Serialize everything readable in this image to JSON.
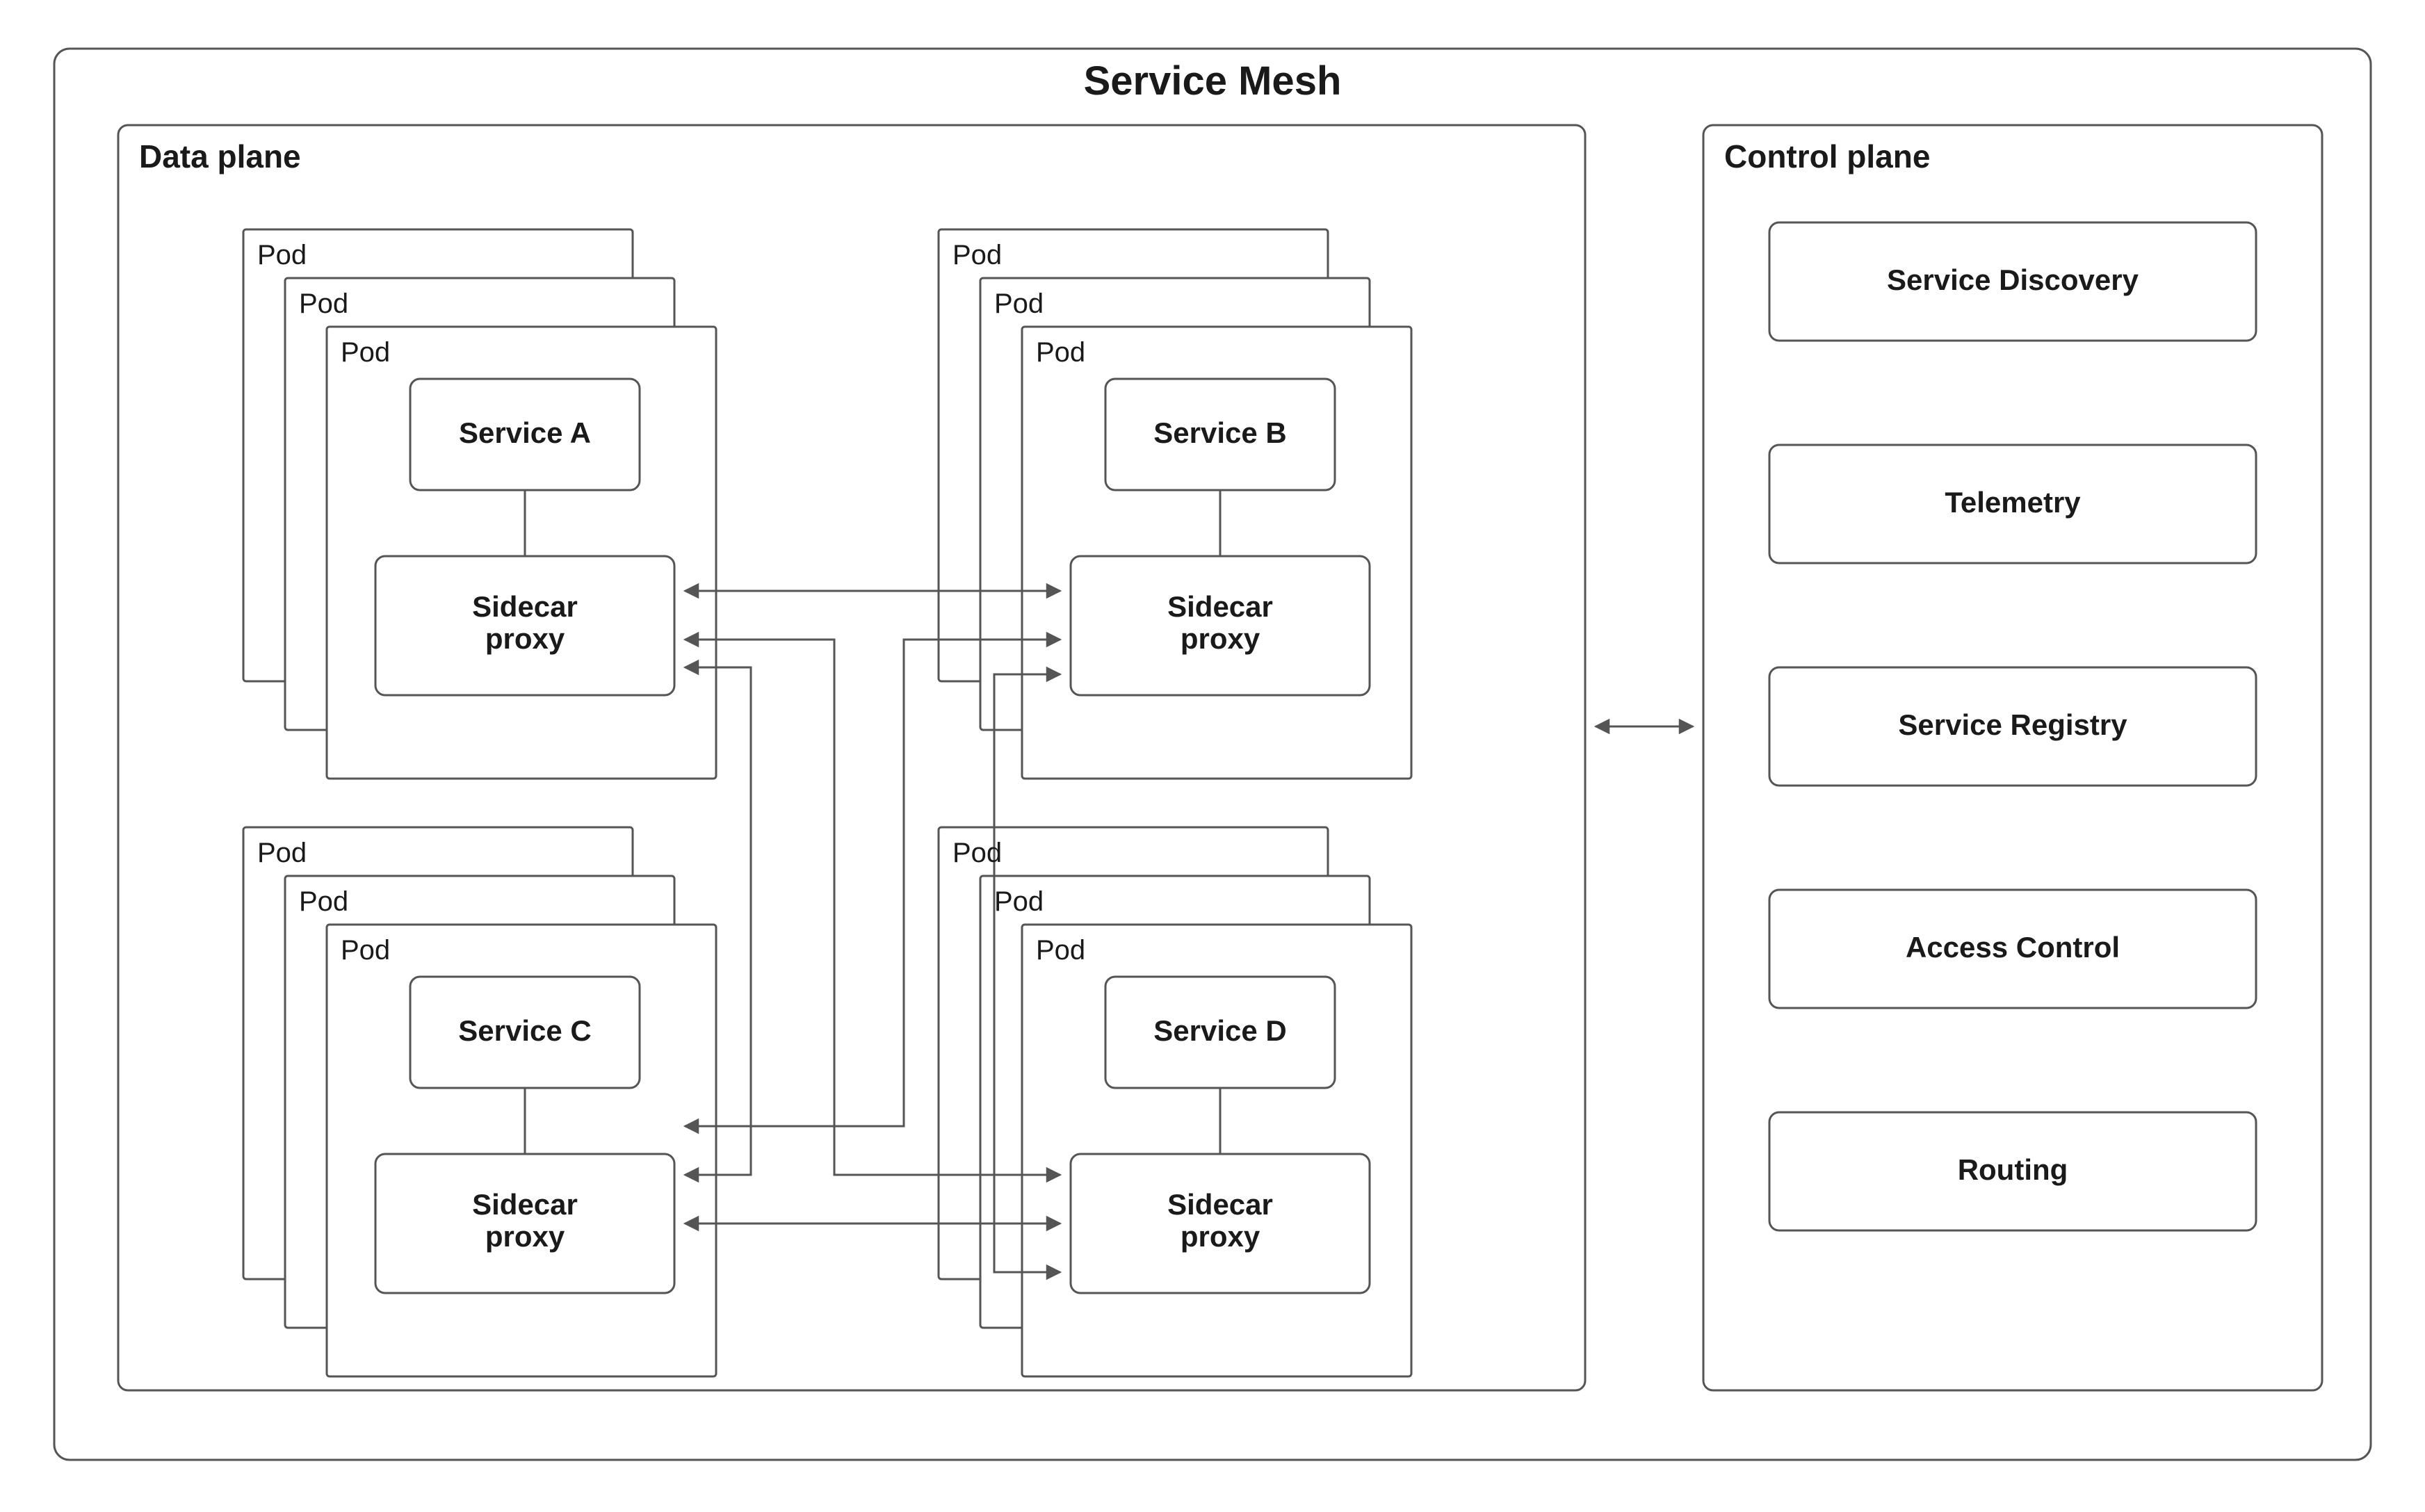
{
  "title": "Service Mesh",
  "data_plane": {
    "label": "Data plane",
    "pods": [
      {
        "label": "Pod",
        "service": "Service A",
        "proxy": "Sidecar\nproxy"
      },
      {
        "label": "Pod",
        "service": "Service B",
        "proxy": "Sidecar\nproxy"
      },
      {
        "label": "Pod",
        "service": "Service C",
        "proxy": "Sidecar\nproxy"
      },
      {
        "label": "Pod",
        "service": "Service D",
        "proxy": "Sidecar\nproxy"
      }
    ]
  },
  "control_plane": {
    "label": "Control plane",
    "items": [
      "Service Discovery",
      "Telemetry",
      "Service Registry",
      "Access Control",
      "Routing"
    ]
  }
}
